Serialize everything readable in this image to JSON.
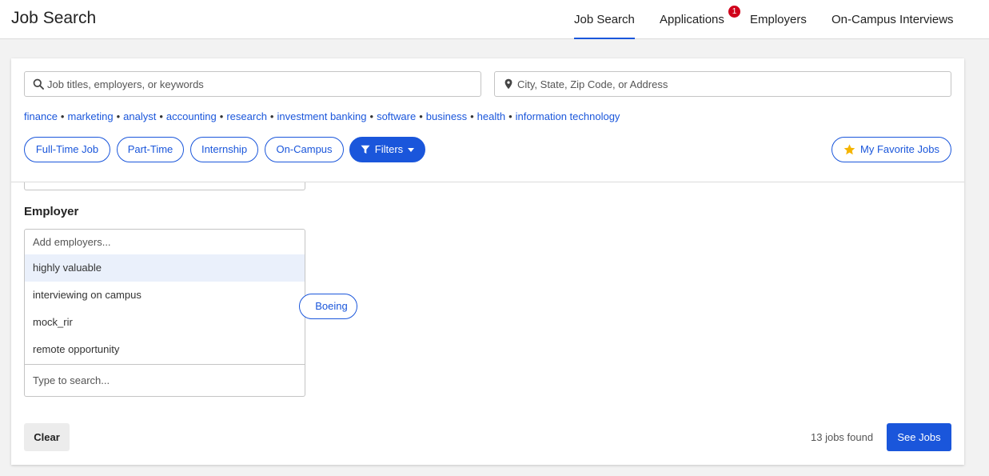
{
  "header": {
    "title": "Job Search",
    "nav": [
      {
        "label": "Job Search",
        "active": true
      },
      {
        "label": "Applications",
        "badge": "1"
      },
      {
        "label": "Employers"
      },
      {
        "label": "On-Campus Interviews"
      }
    ]
  },
  "search": {
    "keywords_placeholder": "Job titles, employers, or keywords",
    "location_placeholder": "City, State, Zip Code, or Address"
  },
  "suggested_keywords": [
    "finance",
    "marketing",
    "analyst",
    "accounting",
    "research",
    "investment banking",
    "software",
    "business",
    "health",
    "information technology"
  ],
  "filter_pills": {
    "full_time": "Full-Time Job",
    "part_time": "Part-Time",
    "internship": "Internship",
    "on_campus": "On-Campus",
    "filters": "Filters",
    "favorites": "My Favorite Jobs"
  },
  "employer": {
    "label": "Employer",
    "input_placeholder": "Add employers...",
    "options": [
      "highly valuable",
      "interviewing on campus",
      "mock_rir",
      "remote opportunity"
    ],
    "highlighted_option": "highly valuable",
    "search_placeholder": "Type to search...",
    "selected_chip": "Boeing"
  },
  "footer": {
    "clear_label": "Clear",
    "jobs_found": "13 jobs found",
    "see_jobs_label": "See Jobs"
  },
  "colors": {
    "accent": "#1a56db",
    "badge": "#d0021b",
    "star": "#f5b400",
    "highlight": "#eaf0fb"
  },
  "icons": {
    "search": "magnifier-icon",
    "location": "map-pin-icon",
    "filter": "funnel-icon",
    "dropdown": "caret-down-icon",
    "favorite": "star-icon"
  }
}
